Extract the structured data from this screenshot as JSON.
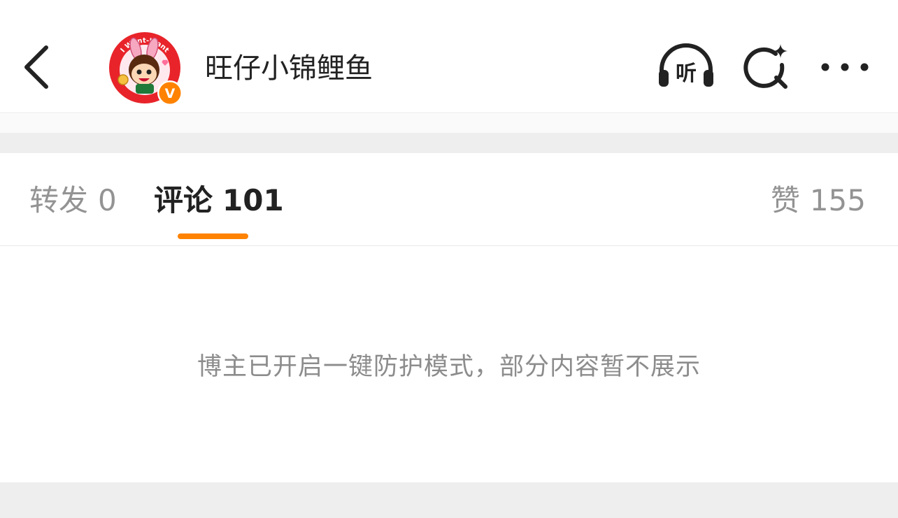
{
  "header": {
    "username": "旺仔小锦鲤鱼",
    "listen_label": "听",
    "avatar_badge_text": "I Want-Want",
    "verified_mark": "V",
    "accent_color": "#ff8200"
  },
  "tabs": [
    {
      "label": "转发",
      "count": "0",
      "active": false
    },
    {
      "label": "评论",
      "count": "101",
      "active": true
    },
    {
      "label": "赞",
      "count": "155",
      "active": false
    }
  ],
  "notice": "博主已开启一键防护模式，部分内容暂不展示"
}
